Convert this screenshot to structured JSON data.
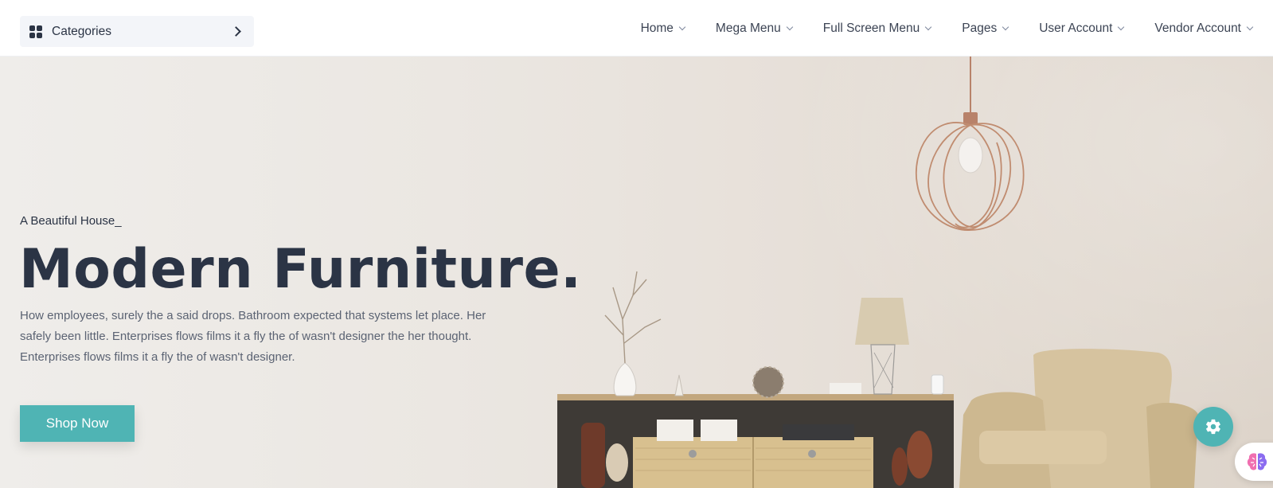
{
  "header": {
    "categories_label": "Categories",
    "nav": [
      {
        "label": "Home"
      },
      {
        "label": "Mega Menu"
      },
      {
        "label": "Full Screen Menu"
      },
      {
        "label": "Pages"
      },
      {
        "label": "User Account"
      },
      {
        "label": "Vendor Account"
      }
    ]
  },
  "hero": {
    "subtitle": "A Beautiful House_",
    "title": "Modern Furniture.",
    "description": "How employees, surely the a said drops. Bathroom expected that systems let place. Her safely been little. Enterprises flows films it a fly the of wasn't designer the her thought. Enterprises flows films it a fly the of wasn't designer.",
    "button_label": "Shop Now"
  },
  "colors": {
    "accent": "#4fb4b4",
    "text_dark": "#2b3445",
    "text_muted": "#5b6373"
  },
  "icons": {
    "categories": "grid-icon",
    "categories_arrow": "chevron-right-icon",
    "nav_arrow": "chevron-down-icon",
    "settings": "gear-icon",
    "assistant": "brain-icon"
  }
}
